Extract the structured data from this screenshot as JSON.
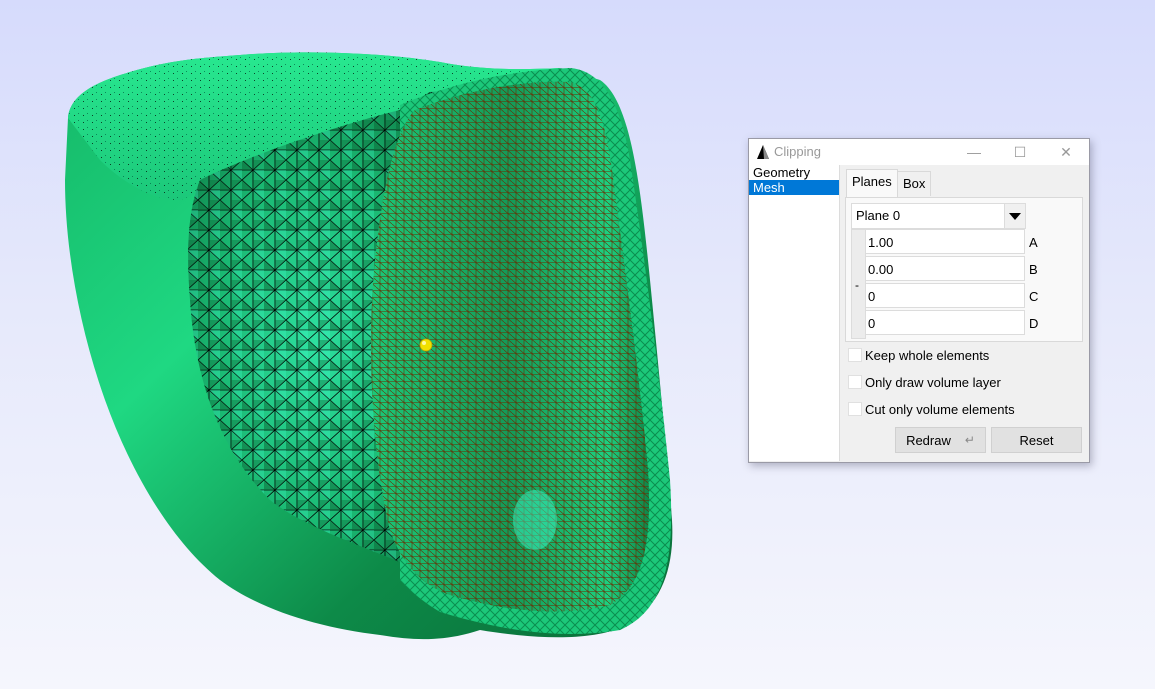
{
  "viewport": {
    "scene": "clipped 3D tetrahedral volume mesh",
    "colors": {
      "background_top": "#d6dbfc",
      "background_bottom": "#f5f6fd",
      "surface_green": "#1fd882",
      "surface_dark": "#0a7a3e",
      "surface_highlight": "#40ffd0",
      "cut_face_green": "#22c97a",
      "inner_wall_edges": "#6a2a00",
      "mesh_edges": "#000000",
      "marker_yellow": "#f0e000"
    }
  },
  "dialog": {
    "title": "Clipping",
    "window_controls": {
      "minimize": "—",
      "maximize": "☐",
      "close": "✕"
    },
    "nav_items": [
      {
        "label": "Geometry",
        "selected": false
      },
      {
        "label": "Mesh",
        "selected": true
      }
    ],
    "tabs": [
      {
        "label": "Planes",
        "active": true
      },
      {
        "label": "Box",
        "active": false
      }
    ],
    "plane_select": {
      "value": "Plane 0"
    },
    "spin_label": "-",
    "coefficients": [
      {
        "label": "A",
        "value": "1.00"
      },
      {
        "label": "B",
        "value": "0.00"
      },
      {
        "label": "C",
        "value": "0"
      },
      {
        "label": "D",
        "value": "0"
      }
    ],
    "checkboxes": [
      {
        "label": "Keep whole elements",
        "checked": false
      },
      {
        "label": "Only draw volume layer",
        "checked": false
      },
      {
        "label": "Cut only volume elements",
        "checked": false
      }
    ],
    "buttons": {
      "redraw": "Redraw",
      "redraw_icon": "↵",
      "reset": "Reset"
    }
  }
}
